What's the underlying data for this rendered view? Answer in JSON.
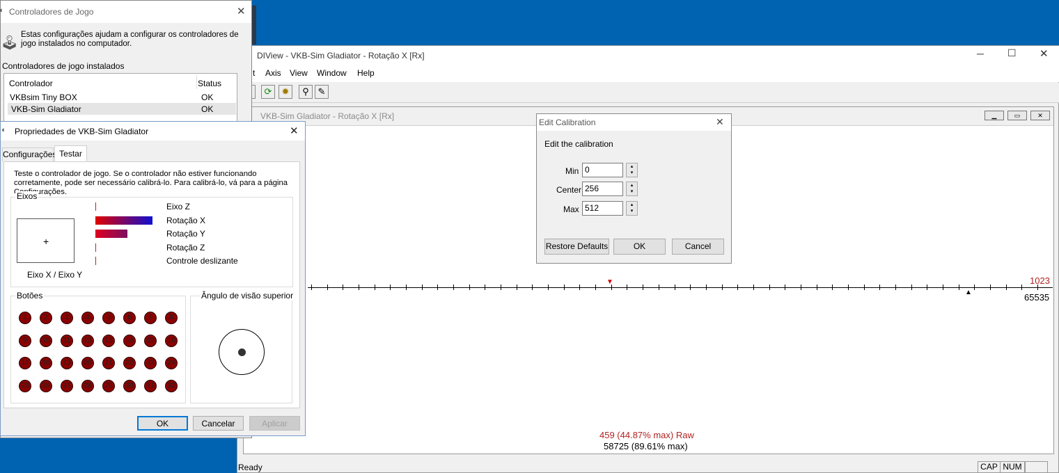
{
  "controllers_window": {
    "title": "Controladores de Jogo",
    "description": "Estas configurações ajudam a configurar os controladores de jogo instalados no computador.",
    "installed_label": "Controladores de jogo instalados",
    "columns": [
      "Controlador",
      "Status"
    ],
    "rows": [
      {
        "name": "VKBsim Tiny BOX",
        "status": "OK"
      },
      {
        "name": "VKB-Sim Gladiator",
        "status": "OK"
      }
    ]
  },
  "properties_window": {
    "title": "Propriedades de  VKB-Sim Gladiator",
    "tabs": [
      "Configurações",
      "Testar"
    ],
    "active_tab": "Testar",
    "intro": "Teste o controlador de jogo. Se o controlador não estiver funcionando corretamente, pode ser necessário calibrá-lo. Para calibrá-lo, vá para a página Configurações.",
    "axes_group": "Eixos",
    "xy_label": "Eixo X / Eixo Y",
    "axes": [
      {
        "label": "Eixo Z",
        "level": 0
      },
      {
        "label": "Rotação X",
        "level": 1.0
      },
      {
        "label": "Rotação Y",
        "level": 0.56
      },
      {
        "label": "Rotação Z",
        "level": 0
      },
      {
        "label": "Controle deslizante",
        "level": 0
      }
    ],
    "buttons_group": "Botões",
    "button_numbers": [
      "1",
      "2",
      "3",
      "4",
      "5",
      "6",
      "7",
      "8",
      "9",
      "10",
      "11",
      "12",
      "13",
      "14",
      "15",
      "16",
      "17",
      "18",
      "19",
      "20",
      "21",
      "22",
      "23",
      "24",
      "25",
      "26",
      "27",
      "28",
      "29",
      "30",
      "31",
      "32"
    ],
    "pov_group": "Ângulo de visão superior",
    "ok": "OK",
    "cancel": "Cancelar",
    "apply": "Aplicar"
  },
  "dlview": {
    "title": "DIView -  VKB-Sim Gladiator  - Rotação X [Rx]",
    "menu": [
      "t",
      "Axis",
      "View",
      "Window",
      "Help"
    ],
    "toolbar_icons": [
      "refresh-icon",
      "settings-icon",
      "search-icon",
      "edit-icon"
    ],
    "child_title": "VKB-Sim Gladiator  - Rotação X [Rx]",
    "scale_max_raw": "1023",
    "scale_max": "65535",
    "raw_readout": "459 (44.87% max)  Raw",
    "value_readout": "58725 (89.61% max)",
    "status": "Ready",
    "indicators": [
      "CAP",
      "NUM"
    ],
    "accent_red": "#b22222"
  },
  "edit_calibration": {
    "title": "Edit Calibration",
    "heading": "Edit the calibration",
    "min_label": "Min",
    "min_value": "0",
    "center_label": "Center",
    "center_value": "256",
    "max_label": "Max",
    "max_value": "512",
    "restore": "Restore Defaults",
    "ok": "OK",
    "cancel": "Cancel"
  }
}
